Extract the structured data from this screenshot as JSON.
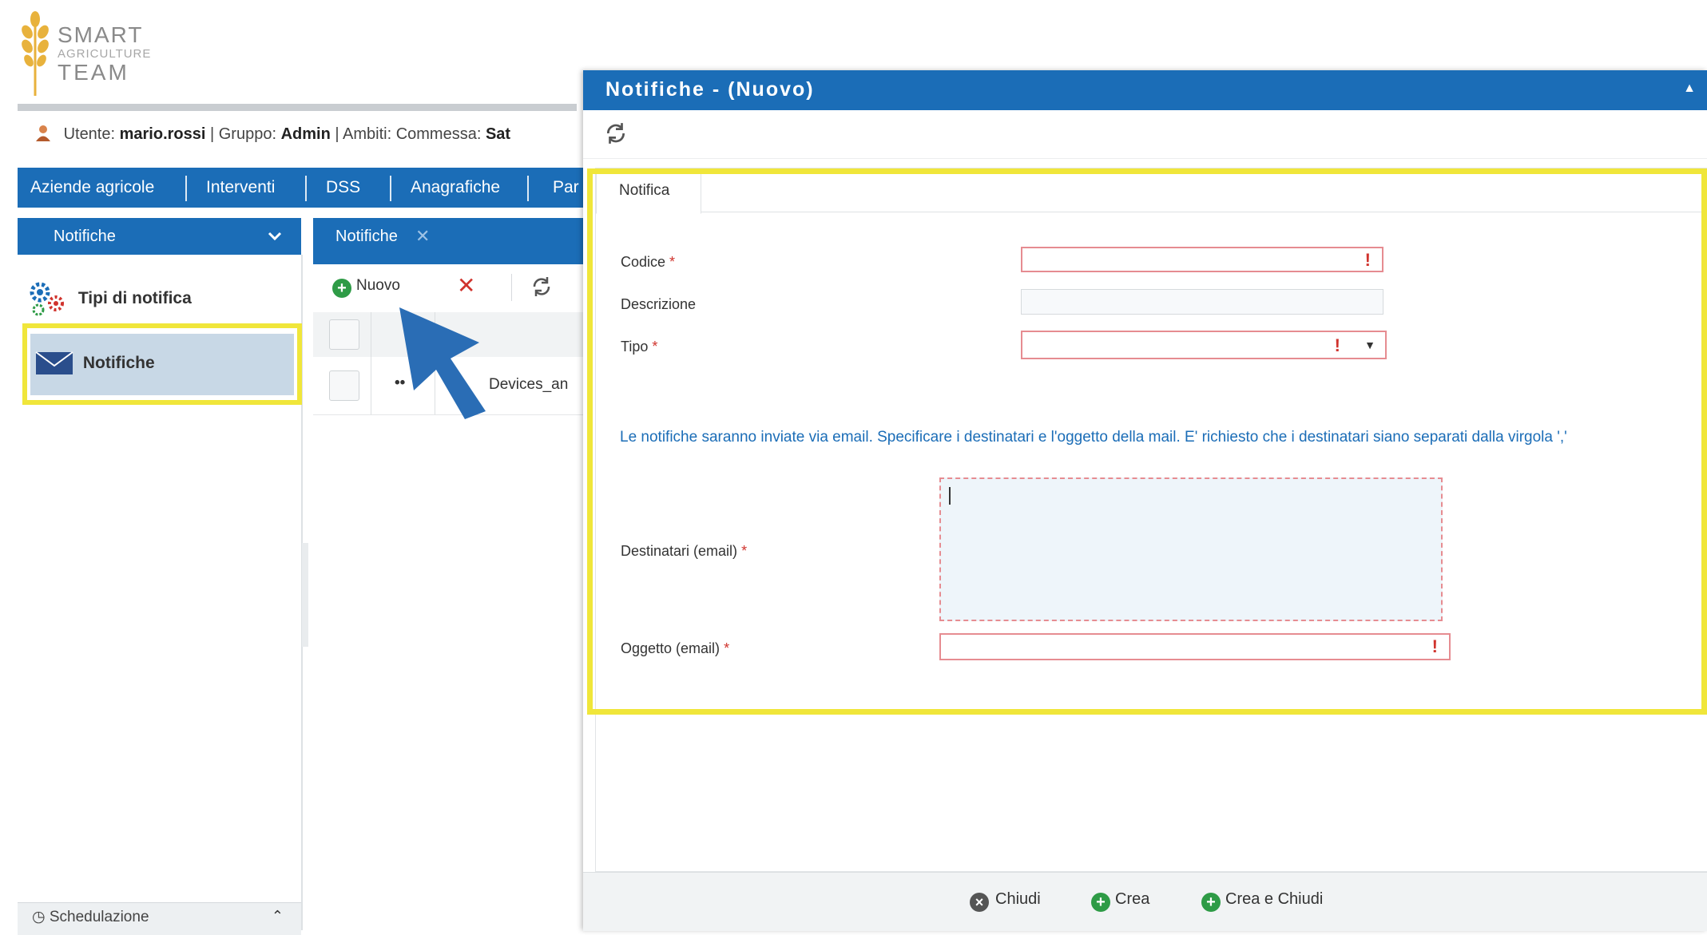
{
  "logo": {
    "line1": "SMART",
    "line2": "AGRICULTURE",
    "line3": "TEAM"
  },
  "user_bar": {
    "user_label": "Utente:",
    "user": "mario.rossi",
    "group_label": "| Gruppo:",
    "group": "Admin",
    "scope_label": "| Ambiti: Commessa:",
    "scope": "Sat"
  },
  "nav": {
    "items": [
      "Aziende agricole",
      "Interventi",
      "DSS",
      "Anagrafiche",
      "Par"
    ]
  },
  "left_panel": {
    "header": "Notifiche",
    "items": [
      "Tipi di notifica",
      "Notifiche"
    ],
    "footer": "Schedulazione"
  },
  "list_panel": {
    "tab": "Notifiche",
    "toolbar": {
      "new_label": "Nuovo"
    },
    "row_text": "Devices_an",
    "row_actions": "••"
  },
  "modal": {
    "title": "Notifiche - (Nuovo)",
    "form_tab": "Notifica",
    "fields": {
      "codice": "Codice",
      "descrizione": "Descrizione",
      "tipo": "Tipo",
      "destinatari": "Destinatari (email)",
      "oggetto": "Oggetto (email)"
    },
    "required_marker": "*",
    "error_marker": "!",
    "info": "Le notifiche saranno inviate via email. Specificare i destinatari e l'oggetto della mail. E' richiesto che i destinatari siano separati dalla virgola ','",
    "footer": {
      "close": "Chiudi",
      "create": "Crea",
      "create_close": "Crea e Chiudi"
    }
  },
  "colors": {
    "primary": "#1b6db7",
    "highlight": "#f0e63a",
    "error": "#d0332d",
    "add": "#2e9b46"
  }
}
